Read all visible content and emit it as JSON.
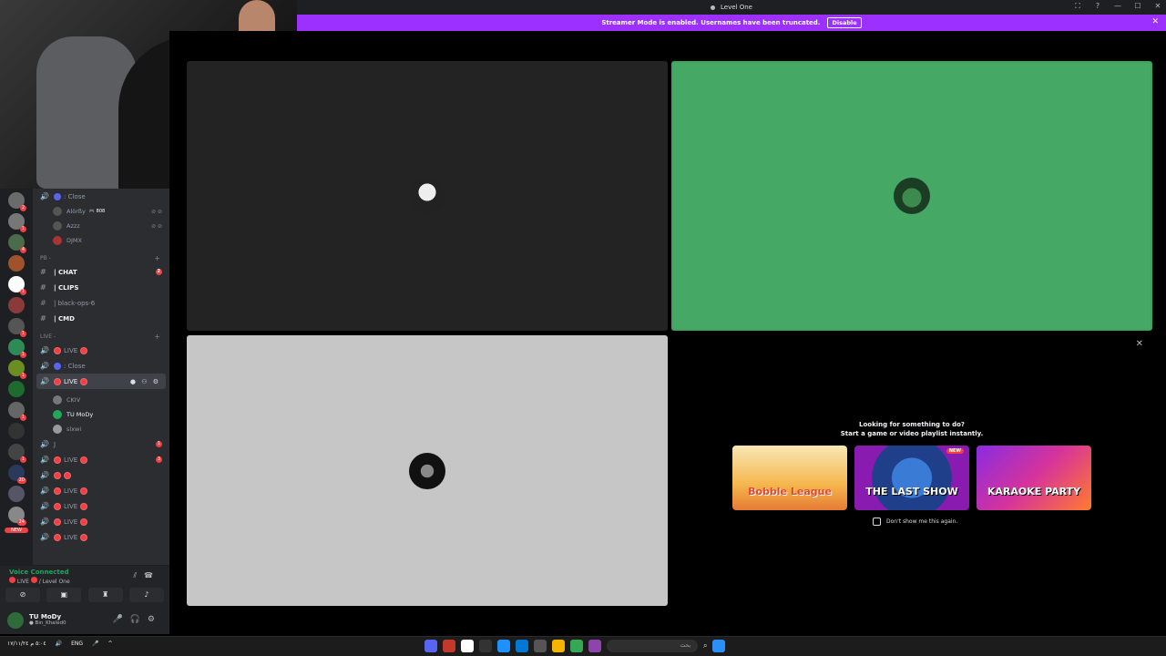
{
  "window": {
    "title": "Level One",
    "controls": [
      "⛶",
      "?",
      "—",
      "☐",
      "✕"
    ]
  },
  "banner": {
    "text": "Streamer Mode is enabled. Usernames have been truncated.",
    "disable_label": "Disable",
    "close": "✕"
  },
  "servers": {
    "badges": [
      "2",
      "1",
      "4",
      "",
      "1",
      "",
      "1",
      "1",
      "1",
      "",
      "1",
      "",
      "1",
      "20",
      "",
      "24"
    ],
    "new_label": "NEW"
  },
  "channels": {
    "top_voice": {
      "label": ": Close"
    },
    "users_top": [
      {
        "name": "Alörßy",
        "tag": "🎮 808"
      },
      {
        "name": "Azzz",
        "tag": ""
      },
      {
        "name": "DJMX",
        "tag": ""
      }
    ],
    "cat_pb": "PB -",
    "pb_channels": [
      {
        "label": "| CHAT",
        "badge": "2"
      },
      {
        "label": "| CLIPS",
        "badge": ""
      },
      {
        "label": "| black-ops-6",
        "badge": ""
      },
      {
        "label": "| CMD",
        "badge": ""
      }
    ],
    "cat_live": "LIVE -",
    "live_1": "LIVE",
    "close_2": ": Close",
    "active_live": "LIVE",
    "active_status": "Set a channel status ✏",
    "active_users": [
      {
        "name": "CKIV"
      },
      {
        "name": "TU MoDy"
      },
      {
        "name": "slxwi"
      }
    ],
    "j_channel": "J",
    "j_badge": "1",
    "bottom_lives": [
      {
        "label": "LIVE",
        "badge": "3"
      },
      {
        "label": "",
        "badge": ""
      },
      {
        "label": "LIVE",
        "badge": ""
      },
      {
        "label": "LIVE",
        "badge": ""
      },
      {
        "label": "LIVE",
        "badge": ""
      },
      {
        "label": "LIVE",
        "badge": ""
      }
    ]
  },
  "voice": {
    "title": "Voice Connected",
    "subtitle_live": "LIVE",
    "subtitle_server": "/ Level One"
  },
  "user": {
    "name": "TU MoDy",
    "status": "● Bin_Khaled0"
  },
  "activity": {
    "title_line1": "Looking for something to do?",
    "title_line2": "Start a game or video playlist instantly.",
    "cards": [
      "Bobble League",
      "THE LAST SHOW",
      "KARAOKE PARTY"
    ],
    "new_tag": "NEW",
    "dont_show": "Don't show me this again."
  },
  "taskbar": {
    "time": "٥:٠٤ م",
    "date": "١٧/١١/٢٤",
    "lang": "ENG",
    "search_placeholder": "بحث"
  },
  "colors": {
    "accent": "#9b30ff",
    "speaking_green": "#45a864",
    "notification_red": "#f23f43"
  }
}
